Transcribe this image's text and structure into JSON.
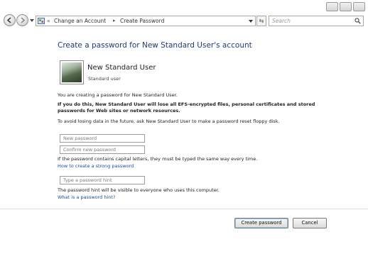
{
  "address": {
    "raquo": "«",
    "crumbs": [
      "Change an Account",
      "Create Password"
    ],
    "separator": "▸"
  },
  "search": {
    "placeholder": "Search"
  },
  "page": {
    "title": "Create a password for New Standard User's account",
    "user": {
      "name": "New Standard User",
      "type": "Standard user"
    },
    "info1": "You are creating a password for New Standard User.",
    "warning_line1": "If you do this, New Standard User will lose all EFS-encrypted files, personal certificates and stored",
    "warning_line2": "passwords for Web sites or network resources.",
    "info2": "To avoid losing data in the future, ask New Standard User to make a password reset floppy disk.",
    "new_password_placeholder": "New password",
    "confirm_password_placeholder": "Confirm new password",
    "caps_note": "If the password contains capital letters, they must be typed the same way every time.",
    "strong_link": "How to create a strong password",
    "hint_placeholder": "Type a password hint",
    "hint_note": "The password hint will be visible to everyone who uses this computer.",
    "hint_link": "What is a password hint?"
  },
  "buttons": {
    "create": "Create password",
    "cancel": "Cancel"
  }
}
